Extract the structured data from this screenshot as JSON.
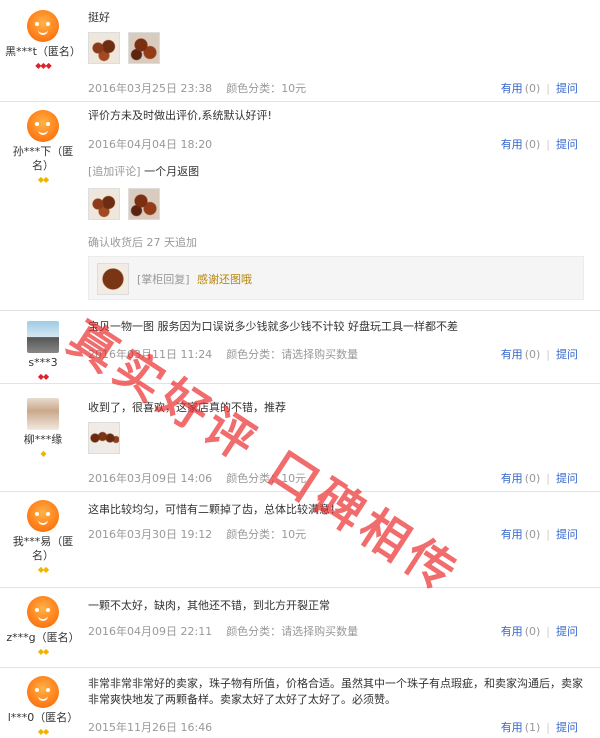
{
  "labels": {
    "useful": "有用",
    "ask": "提问",
    "sku_prefix": "颜色分类："
  },
  "reviews": [
    {
      "user": "黑***t（匿名）",
      "avatar": "orange",
      "badge": "red",
      "badge_count": 3,
      "text": "挺好",
      "images": [
        "beads1",
        "beads2"
      ],
      "date": "2016年03月25日 23:38",
      "sku": "10元",
      "useful_count": "(0)"
    },
    {
      "user": "孙***下（匿名）",
      "avatar": "orange",
      "badge": "gold",
      "badge_count": 2,
      "text": "评价方未及时做出评价,系统默认好评!",
      "date": "2016年04月04日 18:20",
      "sku": "10元",
      "useful_count": "(0)",
      "append_label": "[追加评论]",
      "append_text": "一个月返图",
      "append_images": [
        "beads1",
        "beads2"
      ],
      "append_note": "确认收货后 27 天追加",
      "reply_label": "[掌柜回复]",
      "reply_text": "感谢还图哦"
    },
    {
      "user": "s***3",
      "avatar": "photo1",
      "badge": "red",
      "badge_count": 2,
      "text": "宝贝一物一图 服务因为口误说多少钱就多少钱不计较 好盘玩工具一样都不差",
      "date": "2016年03月11日 11:24",
      "sku": "请选择购买数量",
      "useful_count": "(0)"
    },
    {
      "user": "柳***缘",
      "avatar": "photo2",
      "badge": "gold",
      "badge_count": 1,
      "text": "收到了，很喜欢，这家店真的不错，推荐",
      "images": [
        "beads4"
      ],
      "date": "2016年03月09日 14:06",
      "sku": "10元",
      "useful_count": "(0)"
    },
    {
      "user": "我***易（匿名）",
      "avatar": "orange",
      "badge": "gold",
      "badge_count": 2,
      "text": "这串比较均匀，可惜有二颗掉了齿，总体比较满意！",
      "date": "2016年03月30日 19:12",
      "sku": "10元",
      "useful_count": "(0)"
    },
    {
      "user": "z***g（匿名）",
      "avatar": "orange",
      "badge": "gold",
      "badge_count": 2,
      "text": "一颗不太好，缺肉，其他还不错，到北方开裂正常",
      "date": "2016年04月09日 22:11",
      "sku": "请选择购买数量",
      "useful_count": "(0)"
    },
    {
      "user": "l***0（匿名）",
      "avatar": "orange",
      "badge": "gold",
      "badge_count": 2,
      "text": "非常非常非常好的卖家，珠子物有所值，价格合适。虽然其中一个珠子有点瑕疵，和卖家沟通后，卖家非常爽快地发了两颗备样。卖家太好了太好了太好了。必须赞。",
      "date": "2015年11月26日 16:46",
      "sku": "",
      "useful_count": "(1)"
    }
  ],
  "watermark": "真实好评 口碑相传",
  "colors": {
    "link": "#3366cc",
    "meta": "#999999",
    "watermark": "#eb2828",
    "reply": "#b8860b"
  }
}
